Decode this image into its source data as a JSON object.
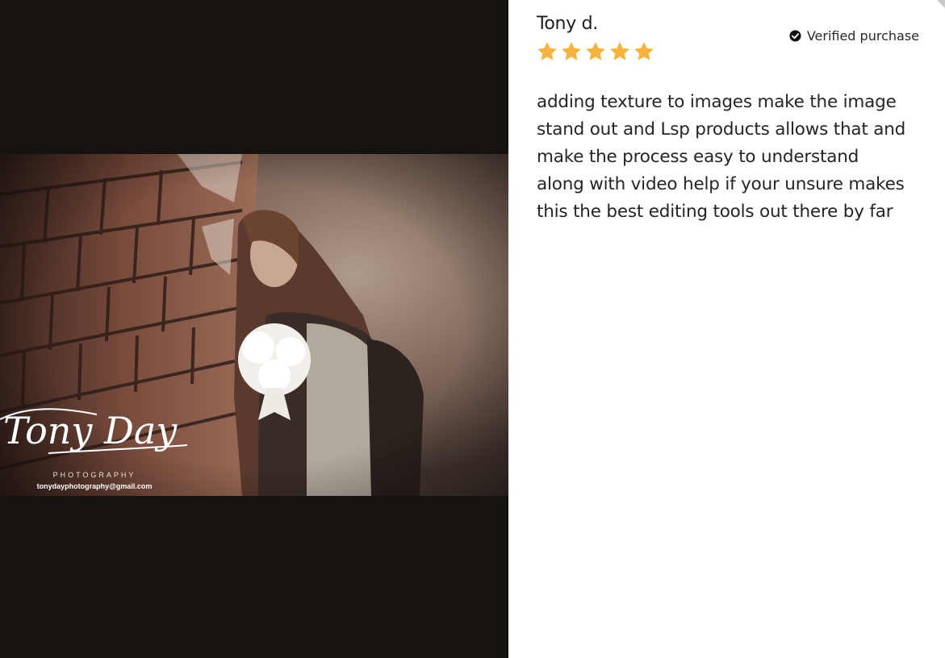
{
  "media": {
    "watermark_signature": "Tony Day",
    "watermark_subtitle": "PHOTOGRAPHY",
    "watermark_email": "tonydayphotography@gmail.com"
  },
  "review": {
    "reviewer_name": "Tony d.",
    "rating": 5,
    "rating_max": 5,
    "verified_label": "Verified purchase",
    "body": "adding texture to images make the image\nstand out and Lsp products allows that and\nmake the process easy to understand\nalong with video help if your unsure makes\nthis the best editing tools out there by far"
  },
  "colors": {
    "media_background": "#161210",
    "star": "#f6b23c",
    "text": "#242424"
  },
  "icons": {
    "star": "star-icon",
    "verified": "check-circle-icon"
  }
}
